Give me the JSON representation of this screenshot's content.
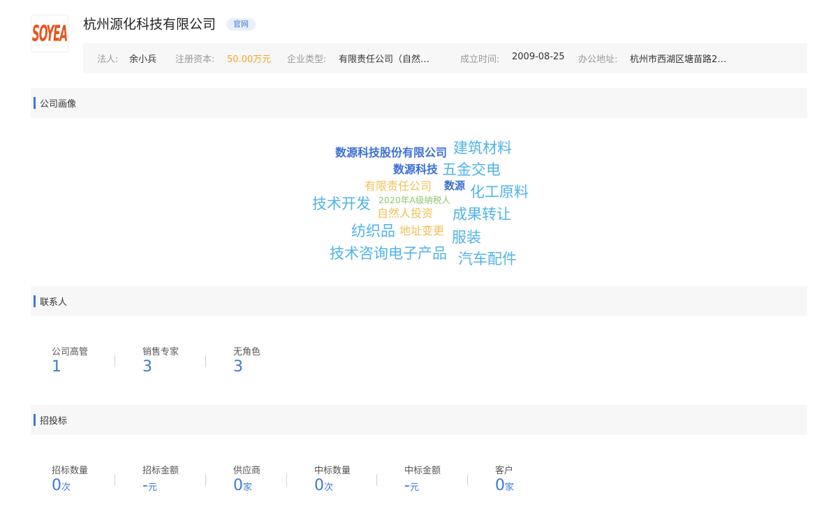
{
  "company": {
    "logo_text": "SOYEA",
    "name": "杭州源化科技有限公司",
    "official_tag": "官网"
  },
  "info": {
    "legal_person_label": "法人:",
    "legal_person": "余小兵",
    "capital_label": "注册资本:",
    "capital": "50.00万元",
    "type_label": "企业类型:",
    "type": "有限责任公司（自然…",
    "founded_label": "成立时间:",
    "founded": "2009-08-25",
    "address_label": "办公地址:",
    "address": "杭州市西湖区塘苗路2…"
  },
  "portrait": {
    "title": "公司画像",
    "words": [
      {
        "text": "数源科技股份有限公司",
        "color": "#3b6fd4"
      },
      {
        "text": "建筑材料",
        "color": "#4fb3e8"
      },
      {
        "text": "数源科技",
        "color": "#3b6fd4"
      },
      {
        "text": "五金交电",
        "color": "#4fb3e8"
      },
      {
        "text": "有限责任公司",
        "color": "#f2c055"
      },
      {
        "text": "数源",
        "color": "#3b6fd4"
      },
      {
        "text": "化工原料",
        "color": "#4fb3e8"
      },
      {
        "text": "技术开发",
        "color": "#4fb3e8"
      },
      {
        "text": "2020年A级纳税人",
        "color": "#8cc76a"
      },
      {
        "text": "自然人投资",
        "color": "#f2c055"
      },
      {
        "text": "成果转让",
        "color": "#4fb3e8"
      },
      {
        "text": "纺织品",
        "color": "#4fb3e8"
      },
      {
        "text": "地址变更",
        "color": "#f2c055"
      },
      {
        "text": "服装",
        "color": "#4fb3e8"
      },
      {
        "text": "技术咨询电子产品",
        "color": "#4fb3e8"
      },
      {
        "text": "汽车配件",
        "color": "#4fb3e8"
      }
    ]
  },
  "contacts": {
    "title": "联系人",
    "stats": [
      {
        "label": "公司高管",
        "value": "1"
      },
      {
        "label": "销售专家",
        "value": "3"
      },
      {
        "label": "无角色",
        "value": "3"
      }
    ]
  },
  "bidding": {
    "title": "招投标",
    "stats": [
      {
        "label": "招标数量",
        "value": "0",
        "unit": "次"
      },
      {
        "label": "招标金额",
        "value": "-",
        "unit": "元"
      },
      {
        "label": "供应商",
        "value": "0",
        "unit": "家"
      },
      {
        "label": "中标数量",
        "value": "0",
        "unit": "次"
      },
      {
        "label": "中标金额",
        "value": "-",
        "unit": "元"
      },
      {
        "label": "客户",
        "value": "0",
        "unit": "家"
      }
    ]
  }
}
